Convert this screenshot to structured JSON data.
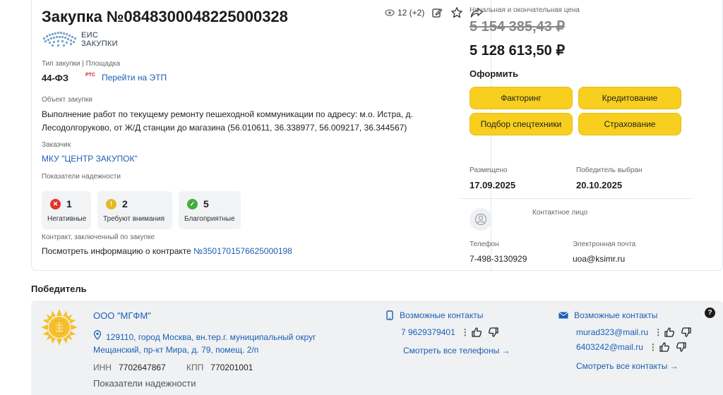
{
  "purchase": {
    "title": "Закупка №0848300048225000328",
    "eis_logo_line1": "ЕИС",
    "eis_logo_line2": "ЗАКУПКИ",
    "views": "12 (+2)",
    "type_label": "Тип закупки | Площадка",
    "law": "44-ФЗ",
    "rts_badge": "РТС",
    "etp_link": "Перейти на ЭТП",
    "object_label": "Объект закупки",
    "object_text": "Выполнение работ по текущему ремонту пешеходной коммуникации по адресу: м.о. Истра, д. Лесодолгоруково, от Ж/Д станции до магазина (56.010611, 36.338977, 56.009217, 36.344567)",
    "customer_label": "Заказчик",
    "customer": "МКУ \"ЦЕНТР ЗАКУПОК\"",
    "reliability_label": "Показатели надежности",
    "reliability": [
      {
        "count": "1",
        "label": "Негативные",
        "color": "#e0332b",
        "symbol": "✕"
      },
      {
        "count": "2",
        "label": "Требуют внимания",
        "color": "#e8b820",
        "symbol": "!"
      },
      {
        "count": "5",
        "label": "Благоприятные",
        "color": "#3fae3a",
        "symbol": "✓"
      }
    ],
    "contract_label": "Контракт, заключенный по закупке",
    "contract_text": "Посмотреть информацию о контракте ",
    "contract_link": "№3501701576625000198"
  },
  "right_panel": {
    "price_label": "Начальная и окончательная цена",
    "price_old": "5 154 385,43 ₽",
    "price_new": "5 128 613,50 ₽",
    "arrange_label": "Оформить",
    "buttons": [
      "Факторинг",
      "Кредитование",
      "Подбор спецтехники",
      "Страхование"
    ],
    "placed_label": "Размещено",
    "placed_date": "17.09.2025",
    "winner_chosen_label": "Победитель выбран",
    "winner_chosen_date": "20.10.2025",
    "contact_label": "Контактное лицо",
    "phone_label": "Телефон",
    "phone": "7-498-3130929",
    "email_label": "Электронная почта",
    "email": "uoa@ksimr.ru"
  },
  "winner": {
    "section_title": "Победитель",
    "name": "ООО \"МГФМ\"",
    "address": "129110, город Москва, вн.тер.г. муниципальный округ Мещанский, пр-кт Мира, д. 79, помещ. 2/п",
    "inn_label": "ИНН",
    "inn": "7702647867",
    "kpp_label": "КПП",
    "kpp": "770201001",
    "reliability_label": "Показатели надежности",
    "phones_title": "Возможные контакты",
    "phone": "7 9629379401",
    "all_phones": "Смотреть все телефоны →",
    "emails_title": "Возможные контакты",
    "emails": [
      "murad323@mail.ru",
      "6403242@mail.ru"
    ],
    "all_contacts": "Смотреть все контакты →",
    "help": "?"
  },
  "icons": [
    "eye-icon",
    "edit-icon",
    "star-icon",
    "share-icon",
    "phone-icon",
    "mail-icon",
    "location-pin-icon",
    "thumb-up-icon",
    "thumb-down-icon",
    "help-icon",
    "avatar-icon"
  ],
  "colors": {
    "accent_link": "#1a5fb4",
    "button_yellow": "#f8cf1e"
  }
}
